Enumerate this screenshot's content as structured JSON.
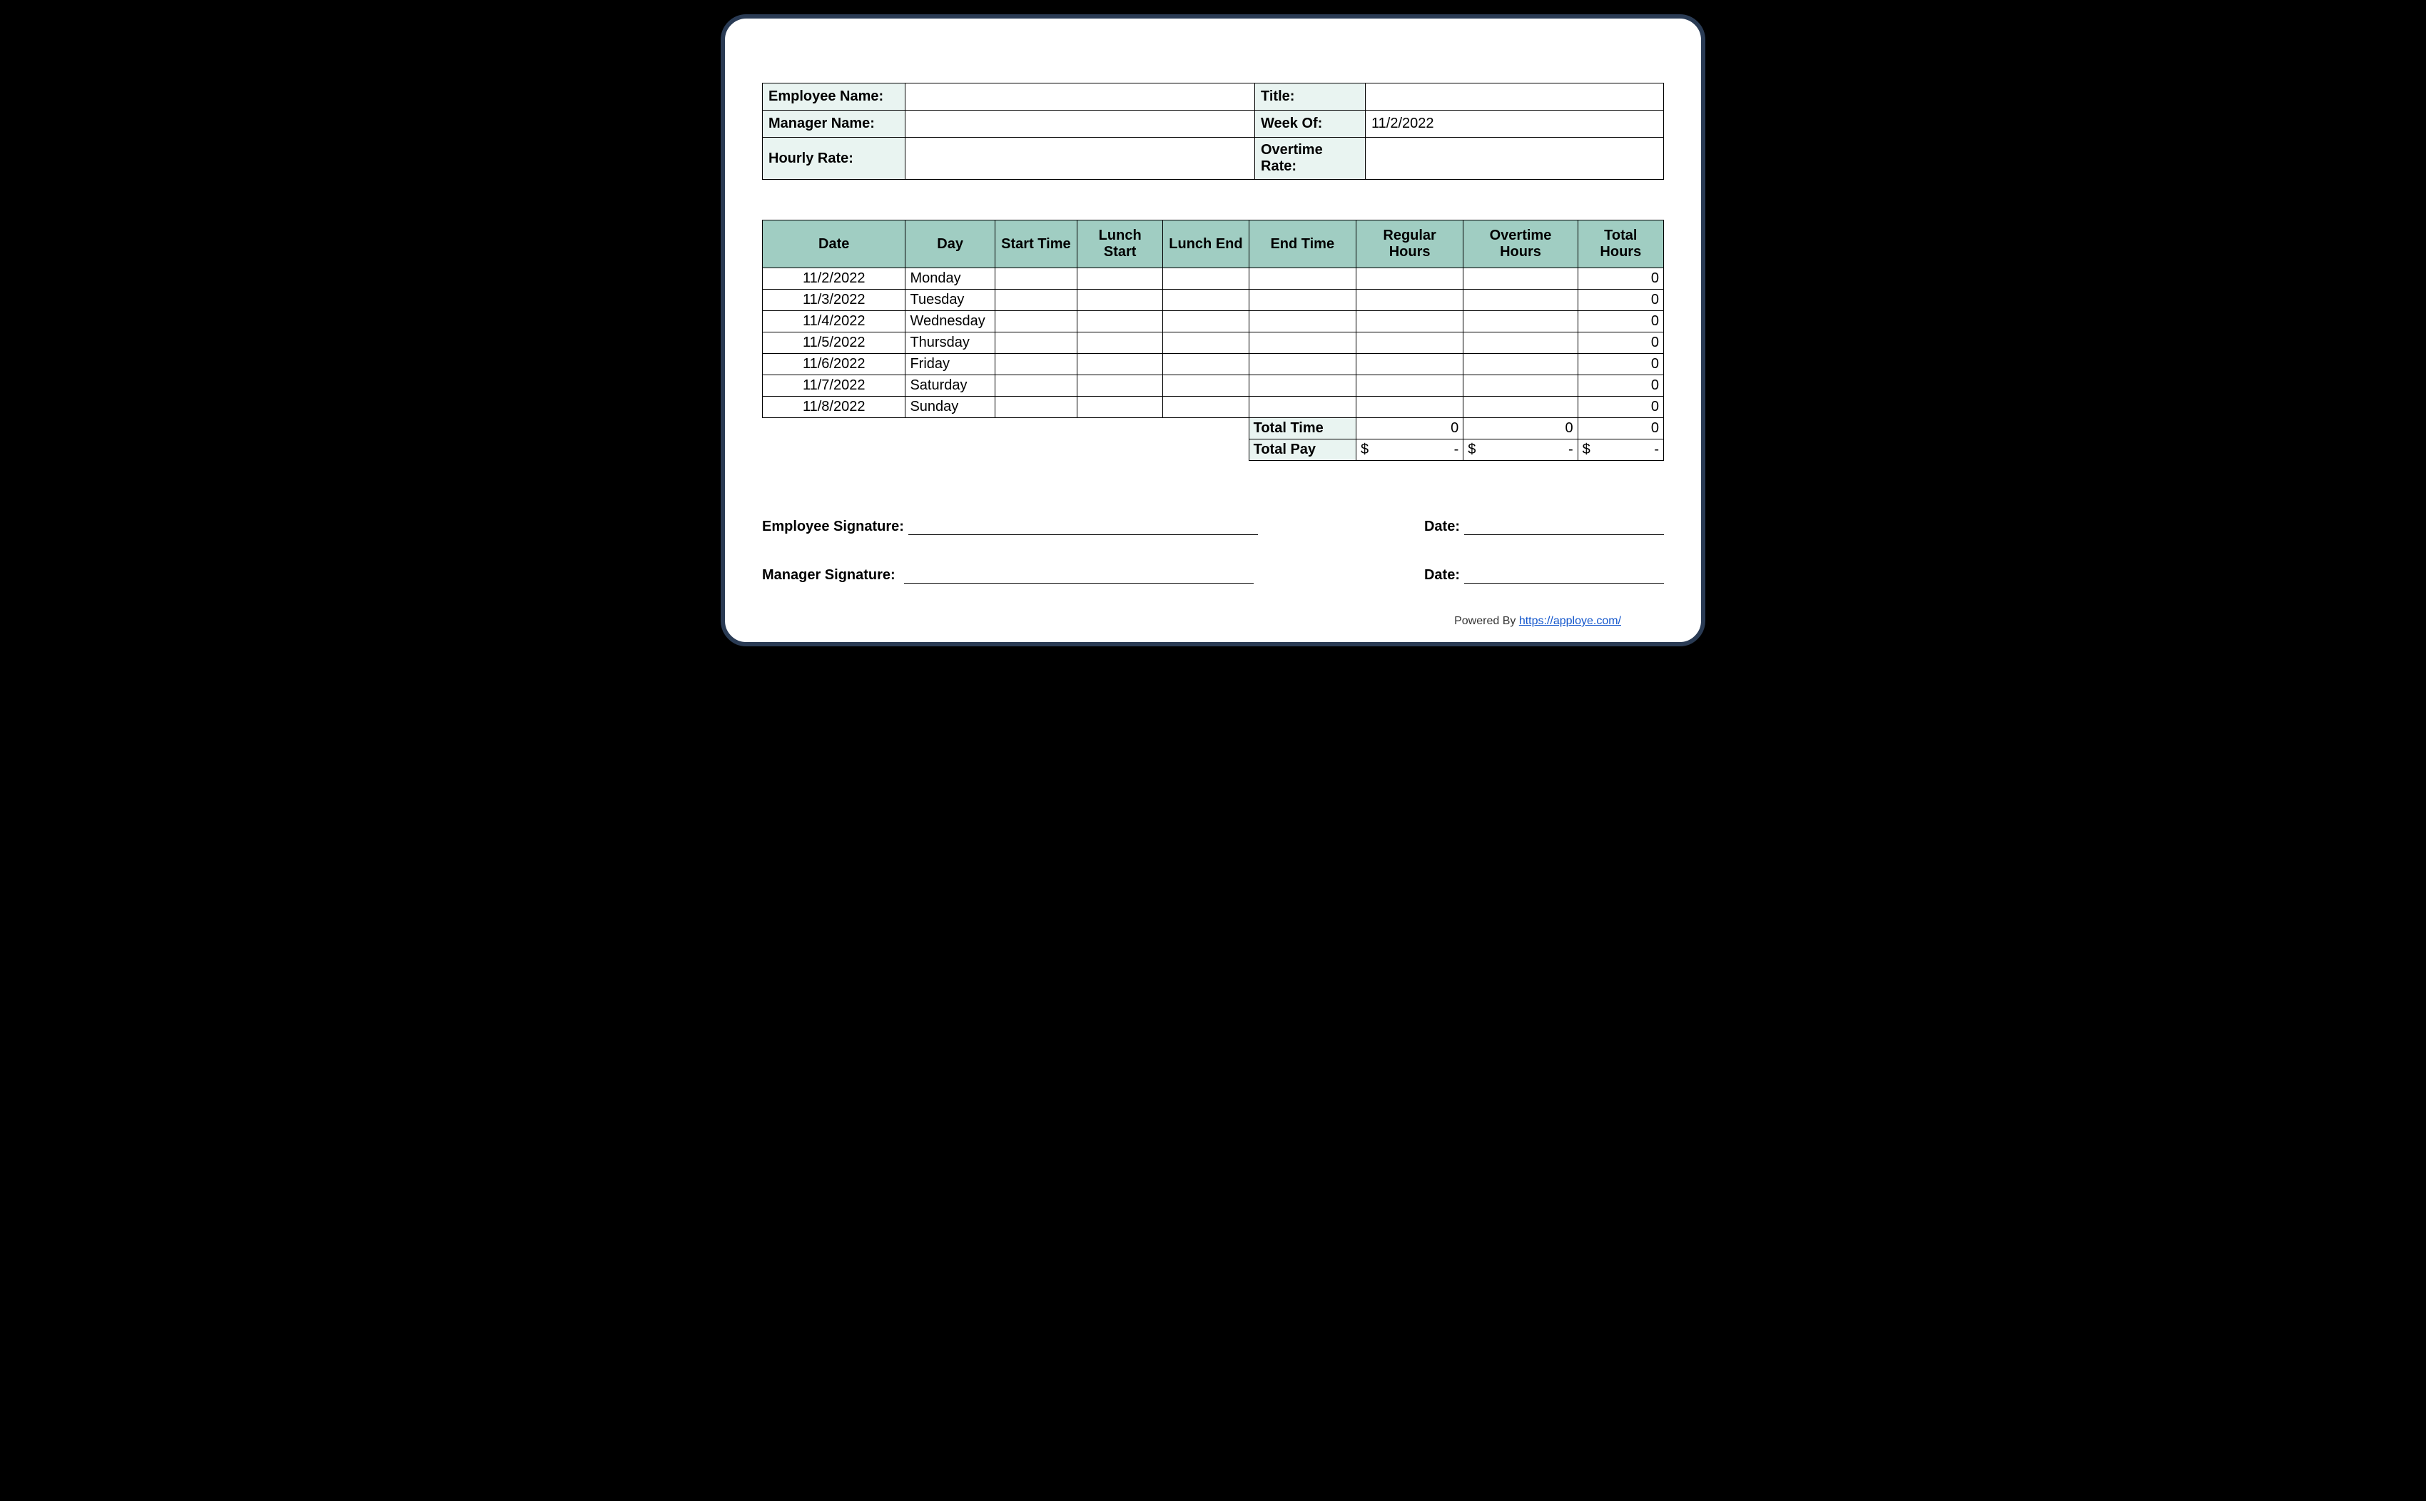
{
  "info": {
    "employee_name_label": "Employee Name:",
    "employee_name_value": "",
    "title_label": "Title:",
    "title_value": "",
    "manager_name_label": "Manager Name:",
    "manager_name_value": "",
    "week_of_label": "Week Of:",
    "week_of_value": "11/2/2022",
    "hourly_rate_label": "Hourly Rate:",
    "hourly_rate_value": "",
    "overtime_rate_label": "Overtime Rate:",
    "overtime_rate_value": ""
  },
  "headers": {
    "date": "Date",
    "day": "Day",
    "start_time": "Start Time",
    "lunch_start": "Lunch Start",
    "lunch_end": "Lunch End",
    "end_time": "End Time",
    "regular_hours": "Regular Hours",
    "overtime_hours": "Overtime Hours",
    "total_hours": "Total Hours"
  },
  "rows": [
    {
      "date": "11/2/2022",
      "day": "Monday",
      "start": "",
      "lstart": "",
      "lend": "",
      "end": "",
      "reg": "",
      "ot": "",
      "total": "0"
    },
    {
      "date": "11/3/2022",
      "day": "Tuesday",
      "start": "",
      "lstart": "",
      "lend": "",
      "end": "",
      "reg": "",
      "ot": "",
      "total": "0"
    },
    {
      "date": "11/4/2022",
      "day": "Wednesday",
      "start": "",
      "lstart": "",
      "lend": "",
      "end": "",
      "reg": "",
      "ot": "",
      "total": "0"
    },
    {
      "date": "11/5/2022",
      "day": "Thursday",
      "start": "",
      "lstart": "",
      "lend": "",
      "end": "",
      "reg": "",
      "ot": "",
      "total": "0"
    },
    {
      "date": "11/6/2022",
      "day": "Friday",
      "start": "",
      "lstart": "",
      "lend": "",
      "end": "",
      "reg": "",
      "ot": "",
      "total": "0"
    },
    {
      "date": "11/7/2022",
      "day": "Saturday",
      "start": "",
      "lstart": "",
      "lend": "",
      "end": "",
      "reg": "",
      "ot": "",
      "total": "0"
    },
    {
      "date": "11/8/2022",
      "day": "Sunday",
      "start": "",
      "lstart": "",
      "lend": "",
      "end": "",
      "reg": "",
      "ot": "",
      "total": "0"
    }
  ],
  "totals": {
    "total_time_label": "Total Time",
    "reg_time": "0",
    "ot_time": "0",
    "total_time": "0",
    "total_pay_label": "Total Pay",
    "reg_pay_sym": "$",
    "reg_pay_val": "-",
    "ot_pay_sym": "$",
    "ot_pay_val": "-",
    "total_pay_sym": "$",
    "total_pay_val": "-"
  },
  "sigs": {
    "employee_sig_label": "Employee Signature:",
    "manager_sig_label": "Manager Signature:",
    "date_label": "Date:"
  },
  "footer": {
    "powered_by": "Powered By ",
    "link_text": "https://apploye.com/"
  }
}
